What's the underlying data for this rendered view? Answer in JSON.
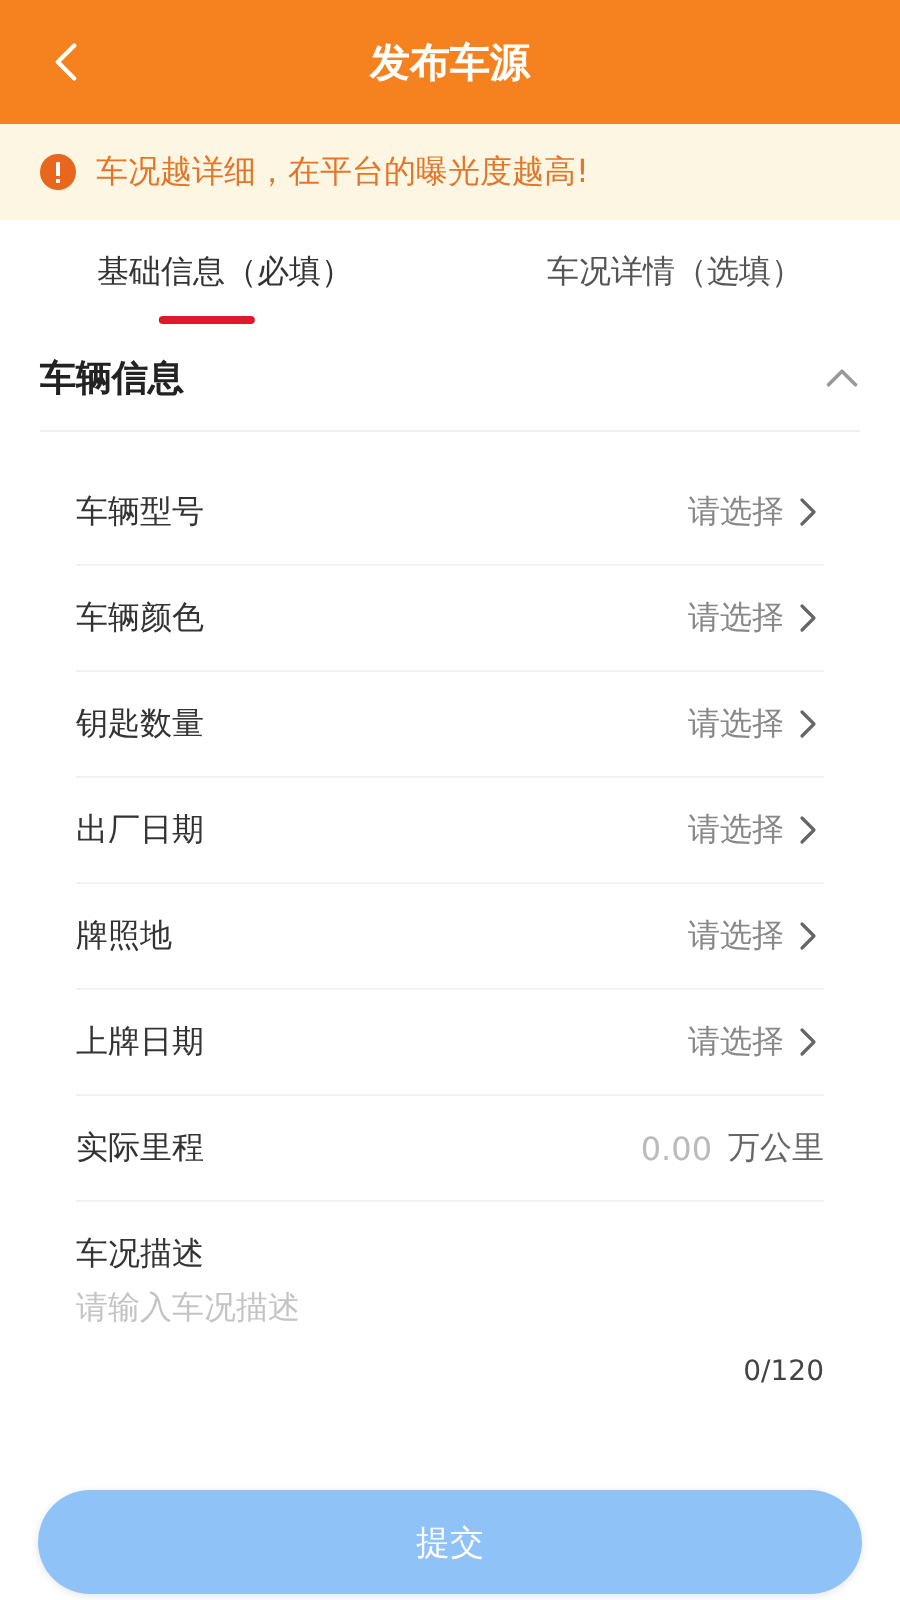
{
  "header": {
    "title": "发布车源"
  },
  "notice": {
    "text": "车况越详细，在平台的曝光度越高!"
  },
  "tabs": [
    {
      "label": "基础信息（必填）",
      "selected": true
    },
    {
      "label": "车况详情（选填）",
      "selected": false
    }
  ],
  "section": {
    "title": "车辆信息",
    "expanded": true
  },
  "fields": [
    {
      "kind": "select",
      "label": "车辆型号",
      "placeholder": "请选择"
    },
    {
      "kind": "select",
      "label": "车辆颜色",
      "placeholder": "请选择"
    },
    {
      "kind": "select",
      "label": "钥匙数量",
      "placeholder": "请选择"
    },
    {
      "kind": "select",
      "label": "出厂日期",
      "placeholder": "请选择"
    },
    {
      "kind": "select",
      "label": "牌照地",
      "placeholder": "请选择"
    },
    {
      "kind": "select",
      "label": "上牌日期",
      "placeholder": "请选择"
    },
    {
      "kind": "number",
      "label": "实际里程",
      "placeholder": "0.00",
      "unit": "万公里"
    }
  ],
  "description": {
    "label": "车况描述",
    "placeholder": "请输入车况描述",
    "counter": "0/120"
  },
  "submit": {
    "label": "提交",
    "disabled": true
  }
}
